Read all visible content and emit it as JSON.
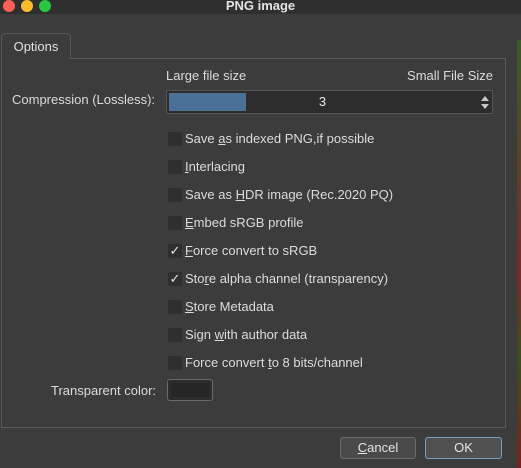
{
  "window": {
    "title": "PNG image"
  },
  "tabs": [
    {
      "label": "Options"
    }
  ],
  "compression": {
    "label": "Compression (Lossless):",
    "min_label": "Large file size",
    "max_label": "Small File Size",
    "value": "3",
    "fill_fraction": 0.25
  },
  "options": [
    {
      "id": "save-indexed",
      "pre": "Save ",
      "mnemonic": "a",
      "post": "s indexed PNG,if possible",
      "checked": false
    },
    {
      "id": "interlacing",
      "pre": "",
      "mnemonic": "I",
      "post": "nterlacing",
      "checked": false
    },
    {
      "id": "save-hdr",
      "pre": "Save as ",
      "mnemonic": "H",
      "post": "DR image (Rec.2020 PQ)",
      "checked": false
    },
    {
      "id": "embed-srgb",
      "pre": "",
      "mnemonic": "E",
      "post": "mbed sRGB profile",
      "checked": false
    },
    {
      "id": "force-srgb",
      "pre": "",
      "mnemonic": "F",
      "post": "orce convert to sRGB",
      "checked": true
    },
    {
      "id": "store-alpha",
      "pre": "Sto",
      "mnemonic": "r",
      "post": "e alpha channel (transparency)",
      "checked": true
    },
    {
      "id": "store-metadata",
      "pre": "",
      "mnemonic": "S",
      "post": "tore Metadata",
      "checked": false
    },
    {
      "id": "sign-author",
      "pre": "Sign ",
      "mnemonic": "w",
      "post": "ith author data",
      "checked": false
    },
    {
      "id": "force-8bit",
      "pre": "Force convert ",
      "mnemonic": "t",
      "post": "o 8 bits/channel",
      "checked": false
    }
  ],
  "transparent_color": {
    "label": "Transparent color:",
    "value_color": "#262626"
  },
  "buttons": {
    "cancel": {
      "mnemonic": "C",
      "rest": "ancel"
    },
    "ok": {
      "label": "OK"
    }
  },
  "colors": {
    "accent": "#4a7097",
    "default_border": "#7a9cc2",
    "background": "#3c3c3c"
  }
}
